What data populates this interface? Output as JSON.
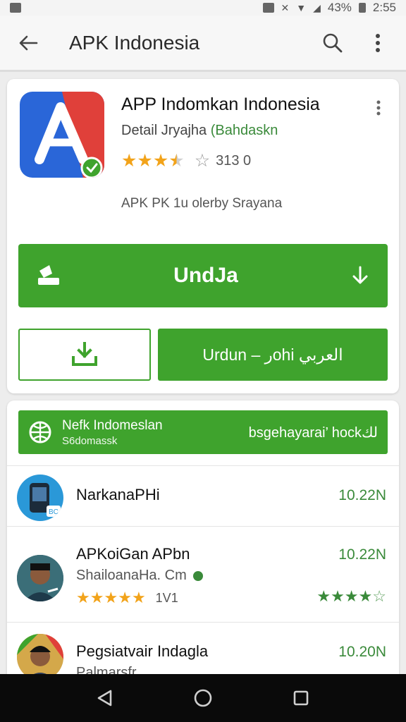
{
  "status_bar": {
    "battery": "43%",
    "time": "2:55"
  },
  "toolbar": {
    "title": "APK Indonesia"
  },
  "app": {
    "name": "APP Indomkan Indonesia",
    "meta_prefix": "Detail Jryajha",
    "meta_accent": "Bahdaskn",
    "rating": 3.5,
    "rating_max": 5,
    "rating_count": "313 0",
    "description": "APK PK 1u olerby Srayana"
  },
  "buttons": {
    "primary_label": "UndJa",
    "secondary_label": "Urdun – رohi العربي"
  },
  "promo": {
    "title": "Nefk Indomeslan",
    "subtitle": "S6domassk",
    "right_text": "bsgehayarai’ hockلك"
  },
  "list": {
    "items": [
      {
        "name": "NarkanaPHi",
        "size": "10.22N"
      },
      {
        "name": "APKoiGan APbn",
        "subtitle": "ShailoanaHa. Cm",
        "rating_label": "1V1",
        "size": "10.22N",
        "left_rating": 5,
        "right_rating": 4
      },
      {
        "name": "Pegsiatvair Indagla",
        "subtitle": "Palmarsfr",
        "size": "10.20N"
      }
    ]
  },
  "colors": {
    "accent_green": "#3fa32d",
    "star_orange": "#f2a31a",
    "logo_red": "#e0403a",
    "logo_blue": "#2a66d8"
  },
  "icons": [
    "back-arrow-icon",
    "search-icon",
    "more-vert-icon",
    "download-arrow-icon",
    "globe-icon",
    "nav-back-icon",
    "nav-home-icon",
    "nav-recents-icon"
  ]
}
